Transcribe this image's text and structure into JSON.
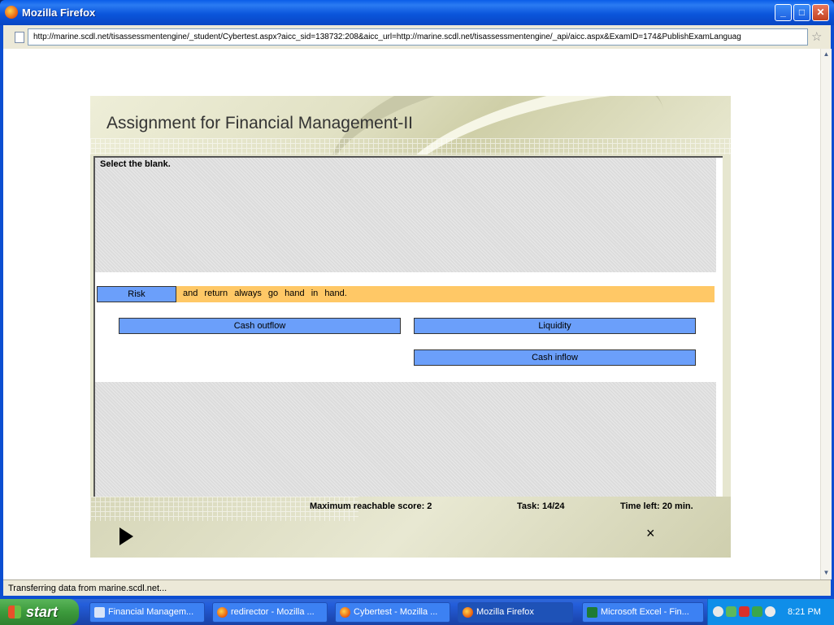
{
  "window": {
    "title": "Mozilla Firefox"
  },
  "browser": {
    "url": "http://marine.scdl.net/tisassessmentengine/_student/Cybertest.aspx?aicc_sid=138732:208&aicc_url=http://marine.scdl.net/tisassessmentengine/_api/aicc.aspx&ExamID=174&PublishExamLanguag",
    "status": "Transferring data from marine.scdl.net..."
  },
  "exam": {
    "title": "Assignment for Financial Management-II",
    "instruction": "Select the blank.",
    "blank_answer": "Risk",
    "sentence_rest": "and return always go hand in hand.",
    "options": [
      "Cash outflow",
      "Liquidity",
      "Cash inflow"
    ],
    "footer": {
      "max_score": "Maximum reachable score: 2",
      "task": "Task: 14/24",
      "time_left": "Time left: 20 min."
    },
    "close_symbol": "×"
  },
  "taskbar": {
    "start": "start",
    "items": [
      {
        "label": "Financial Managem...",
        "icon": "window-icon"
      },
      {
        "label": "redirector - Mozilla ...",
        "icon": "firefox-icon"
      },
      {
        "label": "Cybertest - Mozilla ...",
        "icon": "firefox-icon"
      },
      {
        "label": "Mozilla Firefox",
        "icon": "firefox-icon",
        "active": true
      },
      {
        "label": "Microsoft Excel - Fin...",
        "icon": "excel-icon"
      }
    ],
    "clock": "8:21 PM"
  }
}
